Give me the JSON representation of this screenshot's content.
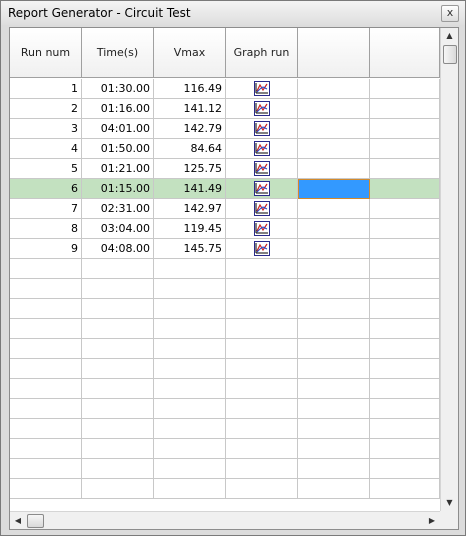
{
  "window": {
    "title": "Report Generator - Circuit Test",
    "close_label": "x"
  },
  "columns": [
    "Run num",
    "Time(s)",
    "Vmax",
    "Graph run",
    ""
  ],
  "rows": [
    {
      "run": "1",
      "time": "01:30.00",
      "vmax": "116.49"
    },
    {
      "run": "2",
      "time": "01:16.00",
      "vmax": "141.12"
    },
    {
      "run": "3",
      "time": "04:01.00",
      "vmax": "142.79"
    },
    {
      "run": "4",
      "time": "01:50.00",
      "vmax": "84.64"
    },
    {
      "run": "5",
      "time": "01:21.00",
      "vmax": "125.75"
    },
    {
      "run": "6",
      "time": "01:15.00",
      "vmax": "141.49"
    },
    {
      "run": "7",
      "time": "02:31.00",
      "vmax": "142.97"
    },
    {
      "run": "8",
      "time": "03:04.00",
      "vmax": "119.45"
    },
    {
      "run": "9",
      "time": "04:08.00",
      "vmax": "145.75"
    }
  ],
  "selected_row": 6,
  "empty_rows": 12,
  "icons": {
    "graph": "graph-chart-icon",
    "scroll_up": "up-arrow",
    "scroll_down": "down-arrow",
    "scroll_left": "left-arrow",
    "scroll_right": "right-arrow"
  },
  "colors": {
    "selected_row": "#c3e1c0",
    "focus_cell": "#3399ff",
    "focus_border": "#d38a2c"
  },
  "scroll": {
    "vertical_glyph_up": "▲",
    "vertical_glyph_down": "▼",
    "horizontal_glyph_left": "◀",
    "horizontal_glyph_right": "▶"
  }
}
